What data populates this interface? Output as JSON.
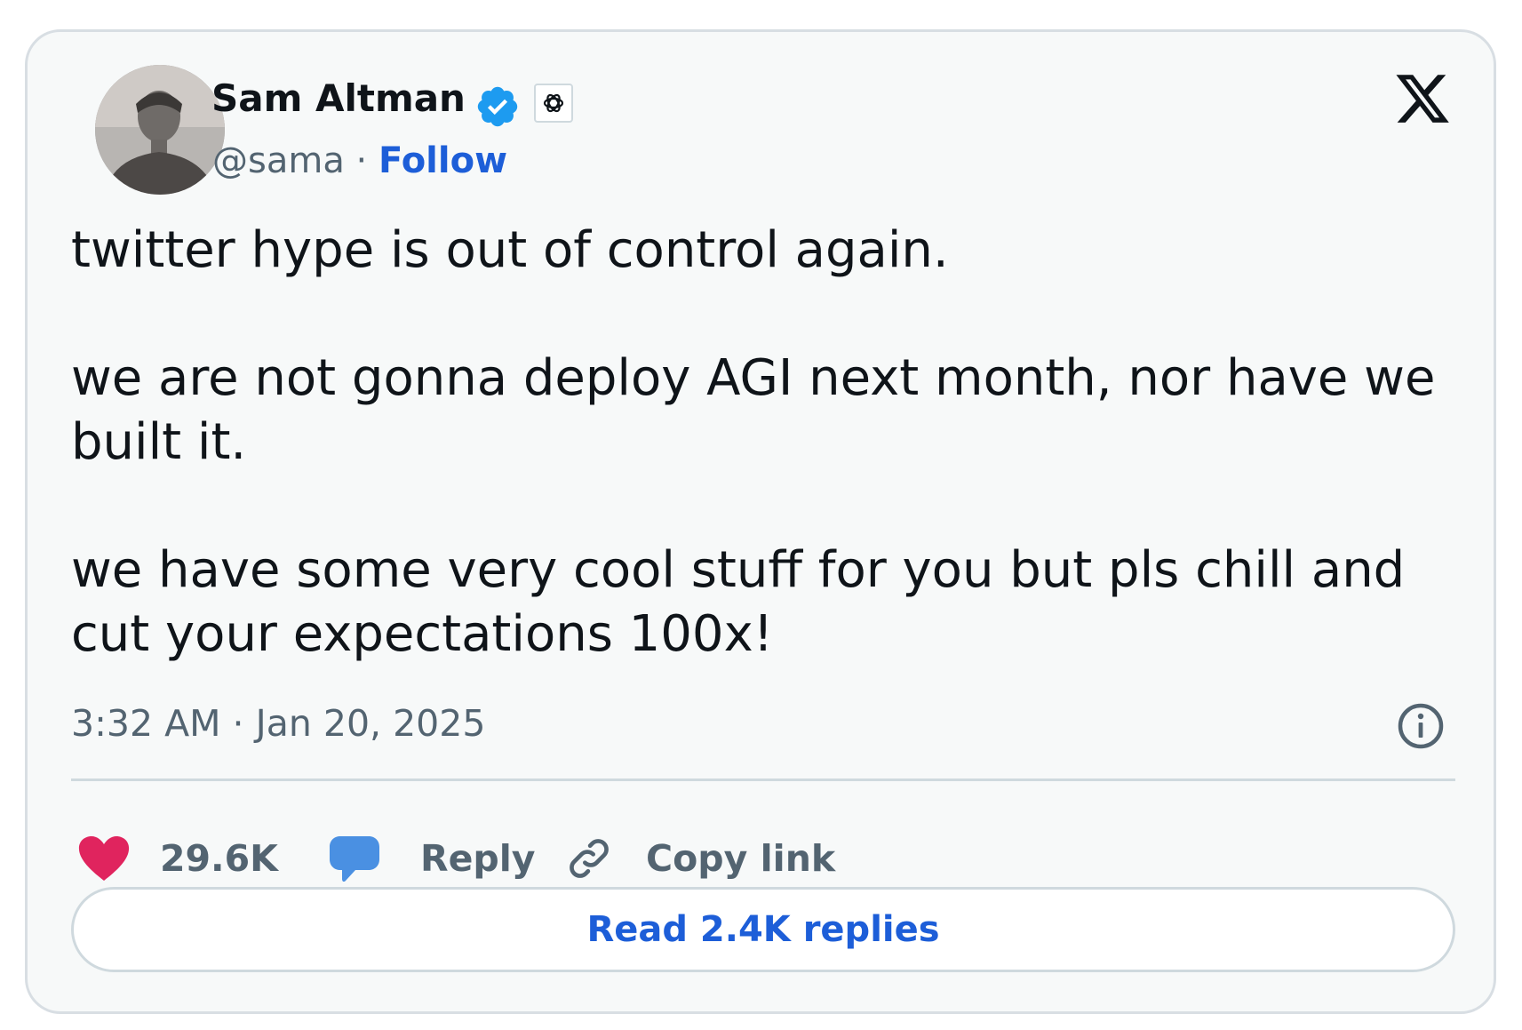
{
  "author": {
    "name": "Sam Altman",
    "handle": "@sama",
    "separator": "·",
    "follow_label": "Follow",
    "verified_icon": "verified-badge-icon",
    "affiliate_icon": "openai-logo-icon"
  },
  "platform": {
    "logo_icon": "x-logo-icon"
  },
  "tweet": {
    "text": "twitter hype is out of control again.\n\nwe are not gonna deploy AGI next month, nor have we built it.\n\nwe have some very cool stuff for you but pls chill and cut your expectations 100x!",
    "timestamp": "3:32 AM · Jan 20, 2025"
  },
  "actions": {
    "like_count": "29.6K",
    "reply_label": "Reply",
    "copy_link_label": "Copy link"
  },
  "replies_button_label": "Read 2.4K replies",
  "colors": {
    "like": "#e0245e",
    "reply": "#4a90e2",
    "link": "#1d5ed8",
    "verified": "#1d9bf0",
    "muted_text": "#536471",
    "card_background": "#f7f9f9"
  }
}
